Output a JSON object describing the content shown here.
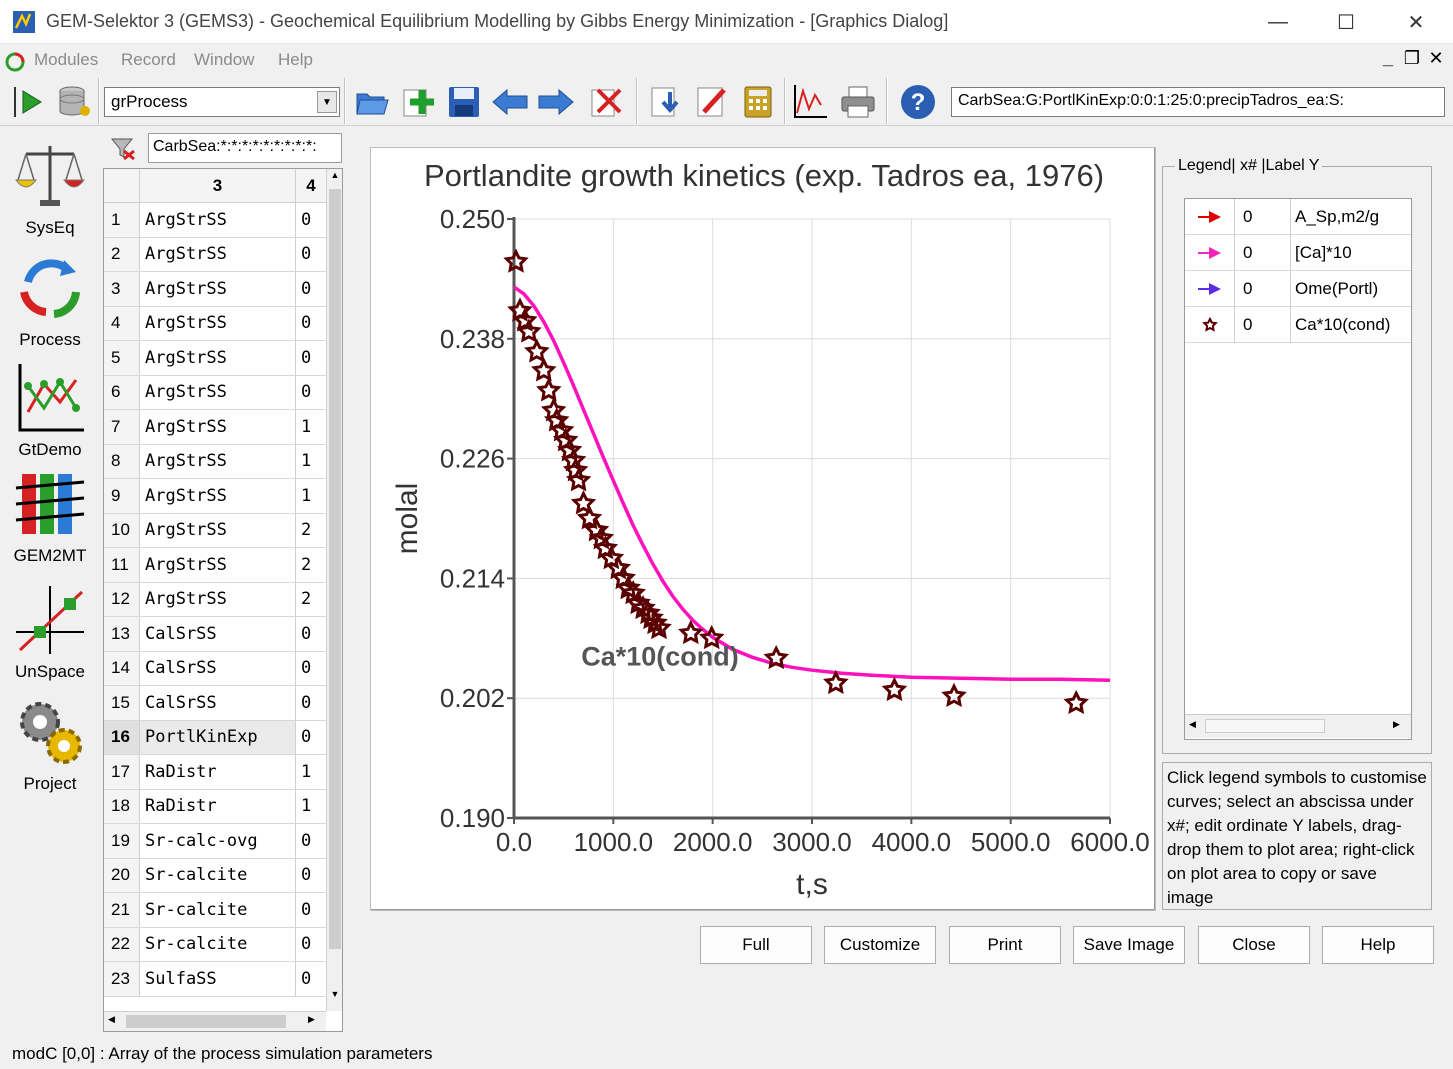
{
  "window": {
    "title": "GEM-Selektor 3 (GEMS3) - Geochemical Equilibrium Modelling by Gibbs Energy Minimization - [Graphics Dialog]",
    "minimize": "—",
    "maximize": "☐",
    "close": "✕"
  },
  "menu": {
    "modules": "Modules",
    "record": "Record",
    "window": "Window",
    "help": "Help"
  },
  "mdi": {
    "minimize": "_",
    "restore": "❐",
    "close": "✕"
  },
  "toolbar": {
    "combo_value": "grProcess",
    "record_key": "CarbSea:G:PortlKinExp:0:0:1:25:0:precipTadros_ea:S:"
  },
  "modules": [
    {
      "label": "SysEq"
    },
    {
      "label": "Process"
    },
    {
      "label": "GtDemo"
    },
    {
      "label": "GEM2MT"
    },
    {
      "label": "UnSpace"
    },
    {
      "label": "Project"
    }
  ],
  "filter": {
    "value": "CarbSea:*:*:*:*:*:*:*:*:*:"
  },
  "grid": {
    "col3": "3",
    "col4": "4",
    "rows": [
      {
        "n": "1",
        "name": "ArgStrSS",
        "v": "0"
      },
      {
        "n": "2",
        "name": "ArgStrSS",
        "v": "0"
      },
      {
        "n": "3",
        "name": "ArgStrSS",
        "v": "0"
      },
      {
        "n": "4",
        "name": "ArgStrSS",
        "v": "0"
      },
      {
        "n": "5",
        "name": "ArgStrSS",
        "v": "0"
      },
      {
        "n": "6",
        "name": "ArgStrSS",
        "v": "0"
      },
      {
        "n": "7",
        "name": "ArgStrSS",
        "v": "1"
      },
      {
        "n": "8",
        "name": "ArgStrSS",
        "v": "1"
      },
      {
        "n": "9",
        "name": "ArgStrSS",
        "v": "1"
      },
      {
        "n": "10",
        "name": "ArgStrSS",
        "v": "2"
      },
      {
        "n": "11",
        "name": "ArgStrSS",
        "v": "2"
      },
      {
        "n": "12",
        "name": "ArgStrSS",
        "v": "2"
      },
      {
        "n": "13",
        "name": "CalSrSS",
        "v": "0"
      },
      {
        "n": "14",
        "name": "CalSrSS",
        "v": "0"
      },
      {
        "n": "15",
        "name": "CalSrSS",
        "v": "0"
      },
      {
        "n": "16",
        "name": "PortlKinExp",
        "v": "0"
      },
      {
        "n": "17",
        "name": "RaDistr",
        "v": "1"
      },
      {
        "n": "18",
        "name": "RaDistr",
        "v": "1"
      },
      {
        "n": "19",
        "name": "Sr-calc-ovg",
        "v": "0"
      },
      {
        "n": "20",
        "name": "Sr-calcite",
        "v": "0"
      },
      {
        "n": "21",
        "name": "Sr-calcite",
        "v": "0"
      },
      {
        "n": "22",
        "name": "Sr-calcite",
        "v": "0"
      },
      {
        "n": "23",
        "name": "SulfaSS",
        "v": "0"
      }
    ]
  },
  "legend": {
    "caption": "Legend| x# |Label Y",
    "rows": [
      {
        "x": "0",
        "label": "A_Sp,m2/g",
        "color": "#e00000",
        "symbol": "arrow"
      },
      {
        "x": "0",
        "label": "[Ca]*10",
        "color": "#ff22bb",
        "symbol": "arrow"
      },
      {
        "x": "0",
        "label": "Ome(Portl)",
        "color": "#5a2ee6",
        "symbol": "arrow"
      },
      {
        "x": "0",
        "label": "Ca*10(cond)",
        "color": "#5a0000",
        "symbol": "star"
      }
    ]
  },
  "help_text": "Click legend symbols to customise curves; select an abscissa under x#; edit ordinate Y labels, drag-drop them to plot area; right-click on plot area to copy or save image",
  "buttons": {
    "full": "Full",
    "customize": "Customize",
    "print": "Print",
    "save_image": "Save Image",
    "close": "Close",
    "help": "Help"
  },
  "status": "modC [0,0] : Array of the process simulation parameters",
  "chart_data": {
    "type": "scatter",
    "title": "Portlandite growth kinetics (exp. Tadros ea, 1976)",
    "xlabel": "t,s",
    "ylabel": "molal",
    "xlim": [
      0,
      6000
    ],
    "ylim": [
      0.19,
      0.25
    ],
    "x_ticks": [
      "0.0",
      "1000.0",
      "2000.0",
      "3000.0",
      "4000.0",
      "5000.0",
      "6000.0"
    ],
    "y_ticks": [
      "0.190",
      "0.202",
      "0.214",
      "0.226",
      "0.238",
      "0.250"
    ],
    "grid": true,
    "annotation": {
      "text": "Ca*10(cond)",
      "x": 1470,
      "y": 0.2053
    },
    "line_color": "#ff11bb",
    "marker_color": "#5a0000",
    "series": [
      {
        "name": "[Ca]*10",
        "kind": "line",
        "x": [
          0,
          100,
          200,
          300,
          400,
          500,
          600,
          700,
          800,
          900,
          1000,
          1100,
          1200,
          1300,
          1400,
          1500,
          1600,
          1700,
          1800,
          1900,
          2000,
          2200,
          2400,
          2600,
          2800,
          3000,
          3300,
          3600,
          4000,
          4500,
          5000,
          5500,
          6000
        ],
        "y": [
          0.2432,
          0.2425,
          0.2413,
          0.2397,
          0.2378,
          0.2356,
          0.2333,
          0.2309,
          0.2285,
          0.2261,
          0.2238,
          0.2215,
          0.2193,
          0.2173,
          0.2154,
          0.2137,
          0.2122,
          0.2109,
          0.2098,
          0.2089,
          0.2081,
          0.2069,
          0.2061,
          0.2055,
          0.2051,
          0.2048,
          0.2045,
          0.2043,
          0.2041,
          0.204,
          0.2039,
          0.2039,
          0.2038
        ]
      },
      {
        "name": "Ca*10(cond)",
        "kind": "scatter",
        "x": [
          20,
          60,
          110,
          150,
          230,
          300,
          350,
          400,
          430,
          480,
          520,
          560,
          600,
          620,
          650,
          700,
          760,
          830,
          880,
          920,
          980,
          1050,
          1100,
          1150,
          1200,
          1250,
          1300,
          1350,
          1380,
          1420,
          1460,
          1780,
          1990,
          2640,
          3240,
          3830,
          4430,
          5660
        ],
        "y": [
          0.2457,
          0.2408,
          0.2398,
          0.2387,
          0.2367,
          0.2348,
          0.2328,
          0.2308,
          0.2298,
          0.2288,
          0.2278,
          0.2268,
          0.2258,
          0.2248,
          0.2238,
          0.2215,
          0.22,
          0.2188,
          0.218,
          0.217,
          0.216,
          0.215,
          0.214,
          0.213,
          0.2125,
          0.2115,
          0.211,
          0.2105,
          0.21,
          0.2095,
          0.209,
          0.2085,
          0.208,
          0.206,
          0.2035,
          0.2028,
          0.2022,
          0.2015
        ]
      }
    ]
  }
}
